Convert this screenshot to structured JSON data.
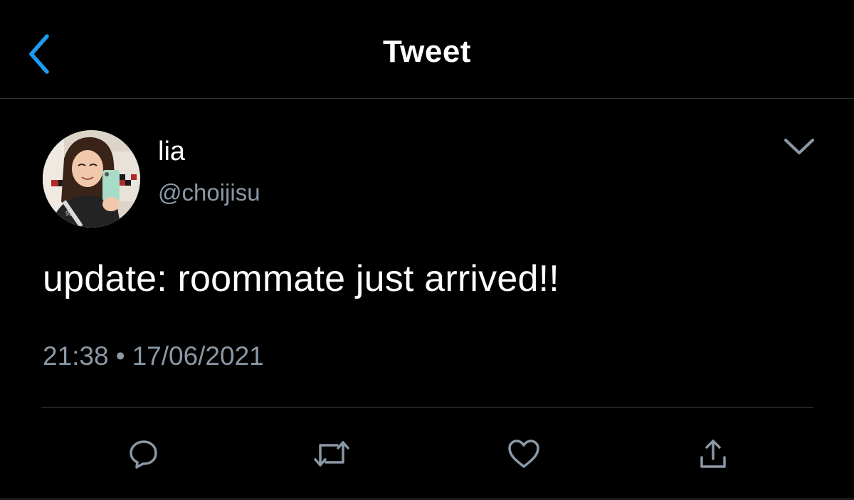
{
  "header": {
    "title": "Tweet",
    "back_icon": "chevron-left-icon"
  },
  "tweet": {
    "author": {
      "display_name": "lia",
      "handle": "@choijisu"
    },
    "text": "update: roommate just arrived!!",
    "time": "21:38",
    "separator": "•",
    "date": "17/06/2021"
  },
  "actions": [
    {
      "name": "reply",
      "icon": "reply-icon"
    },
    {
      "name": "retweet",
      "icon": "retweet-icon"
    },
    {
      "name": "like",
      "icon": "heart-icon"
    },
    {
      "name": "share",
      "icon": "share-icon"
    }
  ],
  "colors": {
    "background": "#000000",
    "accent": "#1d9bf0",
    "secondary_text": "#8b98a5",
    "icon_gray": "#8b98a5",
    "divider": "#2f3336"
  }
}
